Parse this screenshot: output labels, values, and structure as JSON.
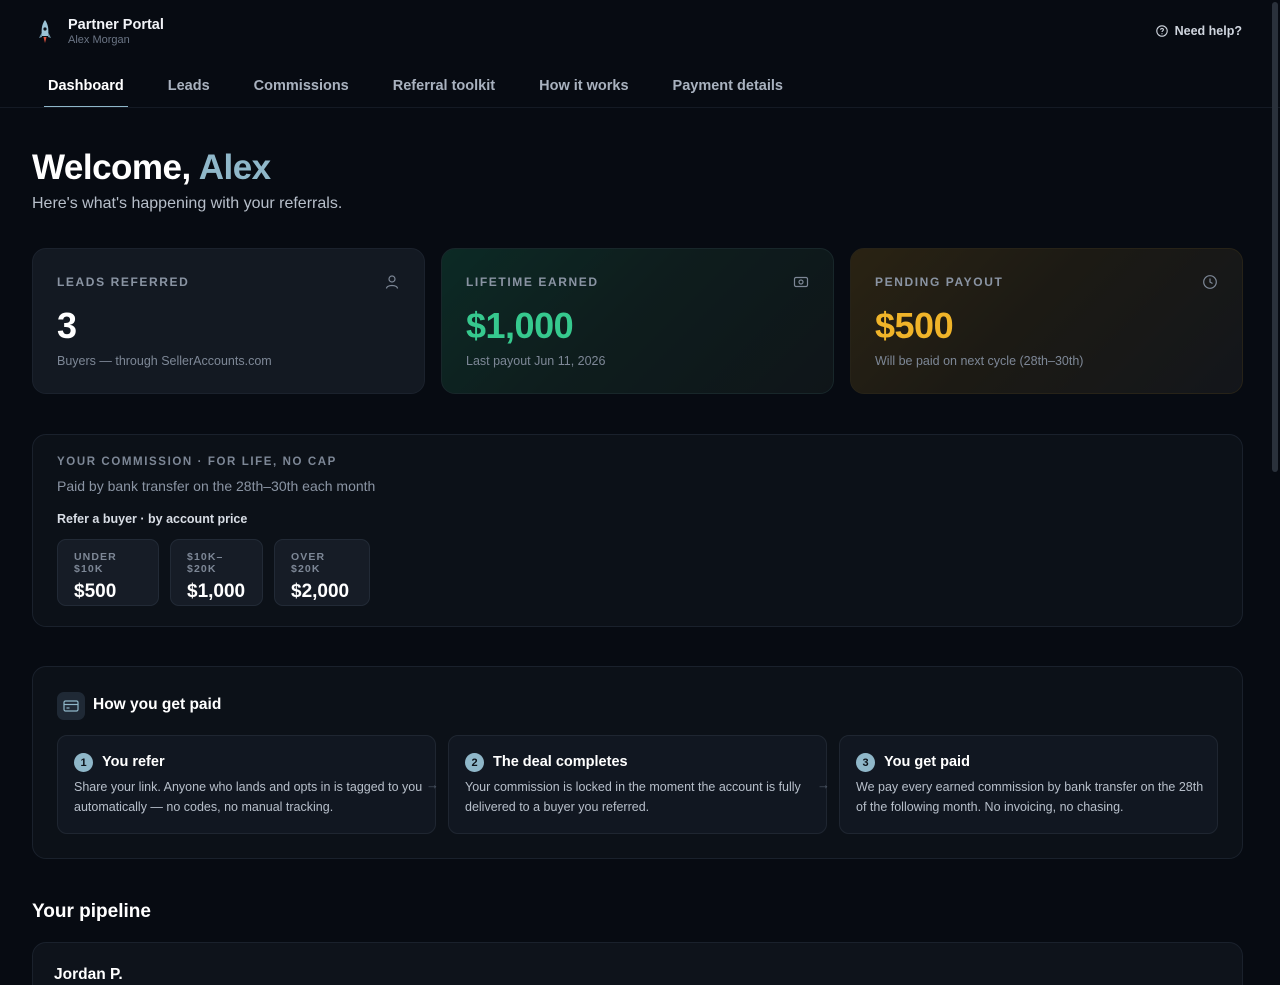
{
  "header": {
    "app_title": "Partner Portal",
    "user_name": "Alex Morgan",
    "help_label": "Need help?"
  },
  "tabs": [
    {
      "label": "Dashboard",
      "active": true
    },
    {
      "label": "Leads",
      "active": false
    },
    {
      "label": "Commissions",
      "active": false
    },
    {
      "label": "Referral toolkit",
      "active": false
    },
    {
      "label": "How it works",
      "active": false
    },
    {
      "label": "Payment details",
      "active": false
    }
  ],
  "welcome": {
    "greeting": "Welcome,",
    "name": "Alex",
    "subtitle": "Here's what's happening with your referrals."
  },
  "stats": [
    {
      "label": "LEADS REFERRED",
      "value": "3",
      "note": "Buyers — through SellerAccounts.com",
      "icon": "user-icon"
    },
    {
      "label": "LIFETIME EARNED",
      "value": "$1,000",
      "note": "Last payout Jun 11, 2026",
      "icon": "banknote-icon",
      "color": "#36c98e"
    },
    {
      "label": "PENDING PAYOUT",
      "value": "$500",
      "note": "Will be paid on next cycle (28th–30th)",
      "icon": "clock-icon",
      "color": "#f0b429"
    }
  ],
  "commission": {
    "heading": "YOUR COMMISSION · FOR LIFE, NO CAP",
    "subheading": "Paid by bank transfer on the 28th–30th each month",
    "refer_label": "Refer a buyer · by account price",
    "tiers": [
      {
        "label": "UNDER $10K",
        "value": "$500"
      },
      {
        "label": "$10K–$20K",
        "value": "$1,000"
      },
      {
        "label": "OVER $20K",
        "value": "$2,000"
      }
    ]
  },
  "how_paid": {
    "title": "How you get paid",
    "icon": "credit-card-icon",
    "steps": [
      {
        "number": "1",
        "title": "You refer",
        "description": "Share your link. Anyone who lands and opts in is tagged to you automatically — no codes, no manual tracking."
      },
      {
        "number": "2",
        "title": "The deal completes",
        "description": "Your commission is locked in the moment the account is fully delivered to a buyer you referred."
      },
      {
        "number": "3",
        "title": "You get paid",
        "description": "We pay every earned commission by bank transfer on the 28th of the following month. No invoicing, no chasing."
      }
    ],
    "arrow": "→"
  },
  "pipeline": {
    "title": "Your pipeline",
    "items": [
      {
        "name": "Jordan P."
      }
    ]
  },
  "colors": {
    "accent": "#8fb7c9",
    "earned": "#36c98e",
    "pending": "#f0b429",
    "background": "#070b12"
  }
}
